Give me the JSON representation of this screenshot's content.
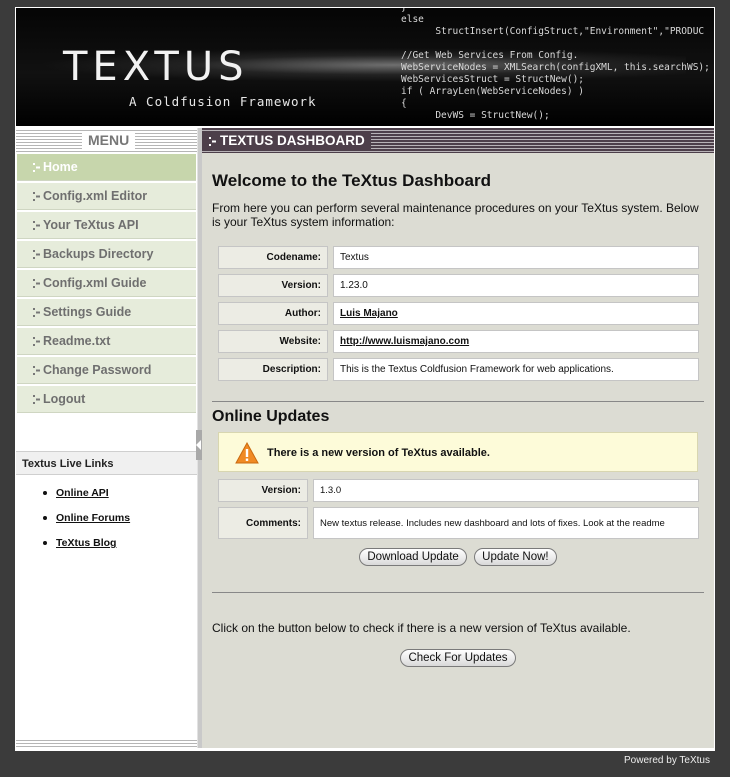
{
  "banner": {
    "logo": "TEXTUS",
    "tagline": "A Coldfusion Framework",
    "code": "}\nelse\n      StructInsert(ConfigStruct,\"Environment\",\"PRODUC\n\n//Get Web Services From Config.\nWebServiceNodes = XMLSearch(configXML, this.searchWS);\nWebServicesStruct = StructNew();\nif ( ArrayLen(WebServiceNodes) )\n{\n      DevWS = StructNew();"
  },
  "sidebar": {
    "menu_title": "MENU",
    "items": [
      {
        "label": "Home"
      },
      {
        "label": "Config.xml Editor"
      },
      {
        "label": "Your TeXtus API"
      },
      {
        "label": "Backups Directory"
      },
      {
        "label": "Config.xml Guide"
      },
      {
        "label": "Settings Guide"
      },
      {
        "label": "Readme.txt"
      },
      {
        "label": "Change Password"
      },
      {
        "label": "Logout"
      }
    ],
    "live_links_title": "Textus Live Links",
    "live_links": [
      {
        "label": "Online API"
      },
      {
        "label": "Online Forums"
      },
      {
        "label": "TeXtus Blog"
      }
    ]
  },
  "main": {
    "header": "TEXTUS DASHBOARD",
    "title": "Welcome to the TeXtus Dashboard",
    "intro": "From here you can perform several maintenance procedures on your TeXtus system. Below is your TeXtus system information:",
    "info": {
      "codename_label": "Codename:",
      "codename": "Textus",
      "version_label": "Version:",
      "version": "1.23.0",
      "author_label": "Author:",
      "author": "Luis Majano",
      "website_label": "Website:",
      "website": "http://www.luismajano.com",
      "description_label": "Description:",
      "description": "This is the Textus Coldfusion Framework for web applications."
    },
    "updates": {
      "title": "Online Updates",
      "alert": "There is a new version of TeXtus available.",
      "version_label": "Version:",
      "version": "1.3.0",
      "comments_label": "Comments:",
      "comments": "New textus release. Includes new dashboard and lots of fixes. Look at the readme",
      "download_button": "Download Update",
      "update_button": "Update Now!"
    },
    "check": {
      "text": "Click on the button below to check if there is a new version of TeXtus available.",
      "button": "Check For Updates"
    }
  },
  "footer": "Powered by TeXtus",
  "colors": {
    "header_bg": "#4d3f4a",
    "nav_active": "#c7d6ac",
    "nav_bg": "#e6ecdb",
    "alert_bg": "#fdfbd9",
    "warning_icon": "#f08a24"
  },
  "icons": {
    "nav_bullet": "dots-icon",
    "alert": "warning-icon"
  }
}
